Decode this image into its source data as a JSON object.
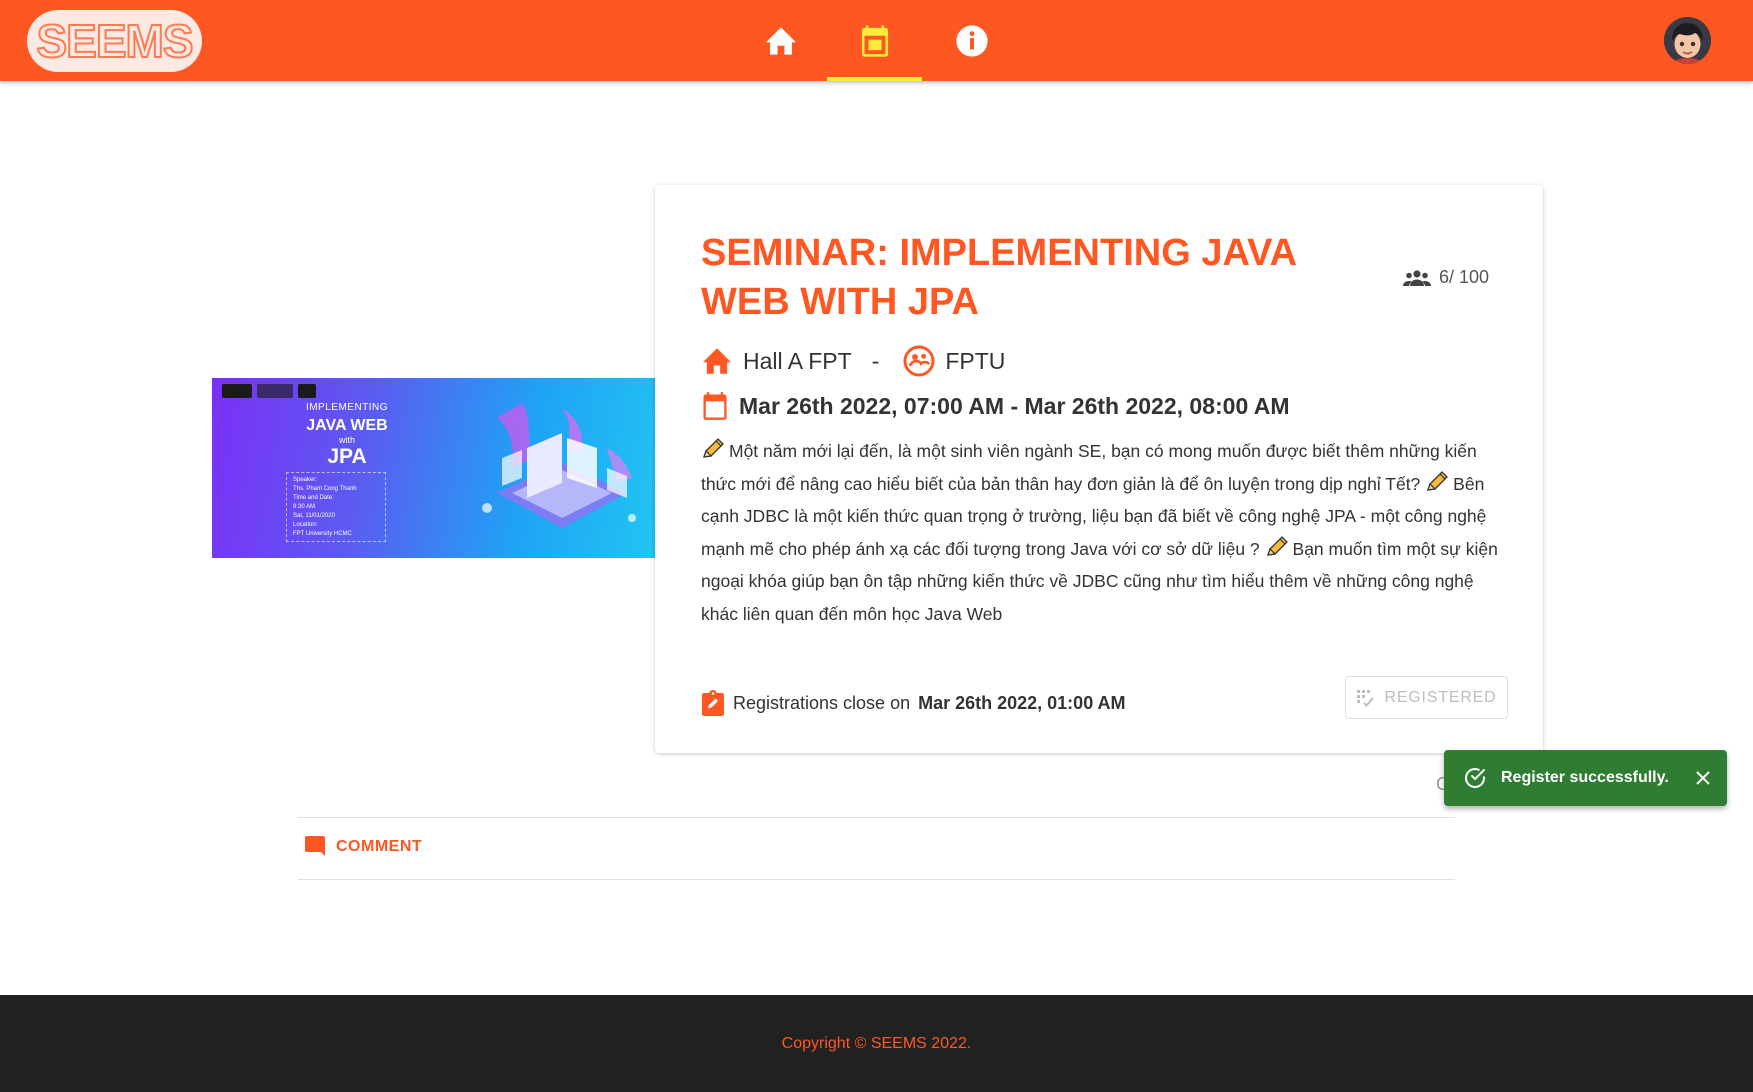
{
  "app": {
    "logo_text": "SEEMS",
    "nav": [
      {
        "icon": "home-icon"
      },
      {
        "icon": "calendar-icon",
        "active": true
      },
      {
        "icon": "info-icon"
      }
    ],
    "accent": "#ff5722",
    "active_indicator": "#ffeb3b"
  },
  "event": {
    "banner": {
      "line1": "IMPLEMENTING",
      "line2": "JAVA WEB",
      "line3": "with",
      "line4": "JPA",
      "info": [
        "Speaker:",
        "Ths. Pham Cong Thanh",
        "Time and Date:",
        "8:30 AM",
        "Sat, 11/01/2020",
        "Location:",
        "FPT University HCMC"
      ]
    },
    "title": "SEMINAR: IMPLEMENTING JAVA WEB WITH JPA",
    "capacity": "6/ 100",
    "location": "Hall A FPT",
    "separator": "-",
    "organizer": "FPTU",
    "datetime": "Mar 26th 2022, 07:00 AM - Mar 26th 2022, 08:00 AM",
    "description": [
      "Một năm mới lại đến, là một sinh viên ngành SE, bạn có mong muốn được biết thêm những kiến thức mới để nâng cao hiểu biết của bản thân hay đơn giản là để ôn luyện trong dịp nghỉ Tết?",
      "Bên cạnh JDBC là một kiến thức quan trọng ở trường, liệu bạn đã biết về công nghệ JPA - một công nghệ mạnh mẽ cho phép ánh xạ các đối tượng trong Java với cơ sở dữ liệu ?",
      "Bạn muốn tìm một sự kiện ngoại khóa giúp bạn ôn tập những kiến thức về JDBC cũng như tìm hiểu thêm về những công nghệ khác liên quan đến môn học Java Web"
    ],
    "registration_prefix": "Registrations close on",
    "registration_close": "Mar 26th 2022, 01:00 AM",
    "register_button": "REGISTERED"
  },
  "stub_text": "C",
  "toast": {
    "message": "Register successfully.",
    "color": "#2e7d32"
  },
  "comment_label": "COMMENT",
  "footer": {
    "copyright": "Copyright © SEEMS 2022."
  }
}
